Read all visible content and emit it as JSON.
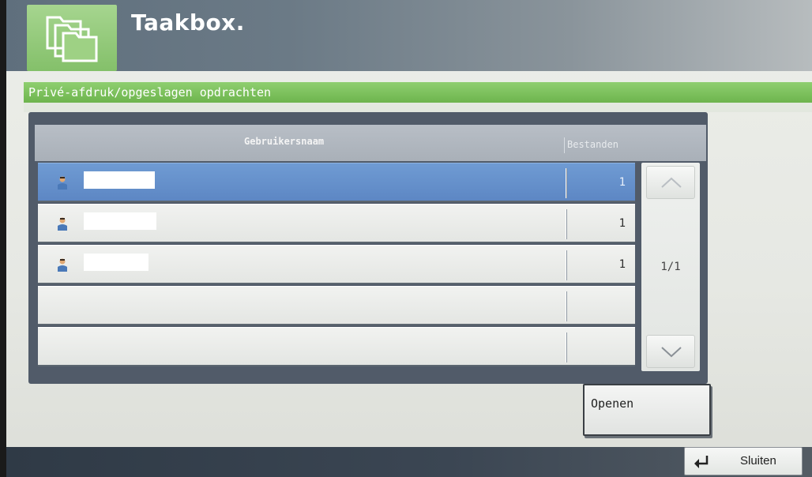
{
  "app": {
    "title": "Taakbox."
  },
  "section": {
    "title": "Privé-afdruk/opgeslagen opdrachten"
  },
  "list": {
    "columns": {
      "username": "Gebruikersnaam",
      "files": "Bestanden"
    },
    "rows": [
      {
        "files": "1",
        "selected": true,
        "user_icon": "user-icon"
      },
      {
        "files": "1",
        "selected": false,
        "user_icon": "user-icon"
      },
      {
        "files": "1",
        "selected": false,
        "user_icon": "user-icon"
      },
      {
        "files": "",
        "selected": false
      },
      {
        "files": "",
        "selected": false
      }
    ]
  },
  "pager": {
    "page": "1/1",
    "up_icon": "chevron-up-icon",
    "down_icon": "chevron-down-icon"
  },
  "actions": {
    "open_label": "Openen",
    "close_label": "Sluiten",
    "close_icon": "return-arrow-icon"
  },
  "colors": {
    "accent_green": "#7cbf5d",
    "selected_row": "#6592cb",
    "header_bar": "#6b7a86"
  }
}
